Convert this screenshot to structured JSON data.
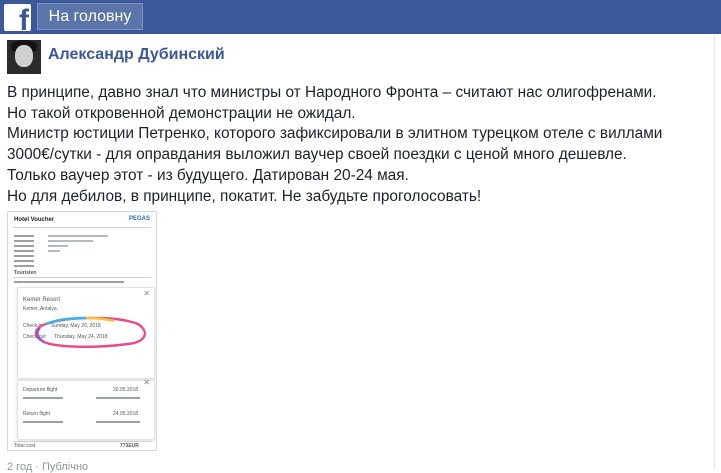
{
  "topbar": {
    "logo_letter": "f",
    "home_label": "На головну"
  },
  "post": {
    "author": "Александр Дубинский",
    "lines": [
      "В принципе, давно знал что министры от Народного Фронта – считают нас олигофренами.",
      "Но такой откровенной демонстрации не ожидал.",
      "Министр юстиции Петренко, которого зафиксировали в элитном турецком отеле с виллами",
      "3000€/сутки - для оправдания выложил ваучер своей поездки с ценой много дешевле.",
      "Только ваучер этот - из будущего. Датирован 20-24 мая.",
      "Но для дебилов, в принципе, покатит. Не забудьте проголосовать!"
    ],
    "footer": "2 год · Публічно"
  },
  "voucher": {
    "title": "Hotel Voucher",
    "brand": "PEGAS",
    "section": "Touristen",
    "hotel": "Kemer Resort",
    "location": "Kemer, Antalya",
    "checkin_label": "Check-in",
    "checkin_date": "Sunday, May 20, 2018",
    "checkout_label": "Check-out",
    "checkout_date": "Thursday, May 24, 2018",
    "departure_label": "Departure flight",
    "departure_date": "20.05.2018",
    "return_label": "Return flight",
    "return_date": "24.05.2018",
    "total_label": "Total cost",
    "total_value": "773EUR",
    "highlight_colors": [
      "#e84a8a",
      "#3bb3e8",
      "#f0c23b",
      "#8e5bd6"
    ]
  }
}
